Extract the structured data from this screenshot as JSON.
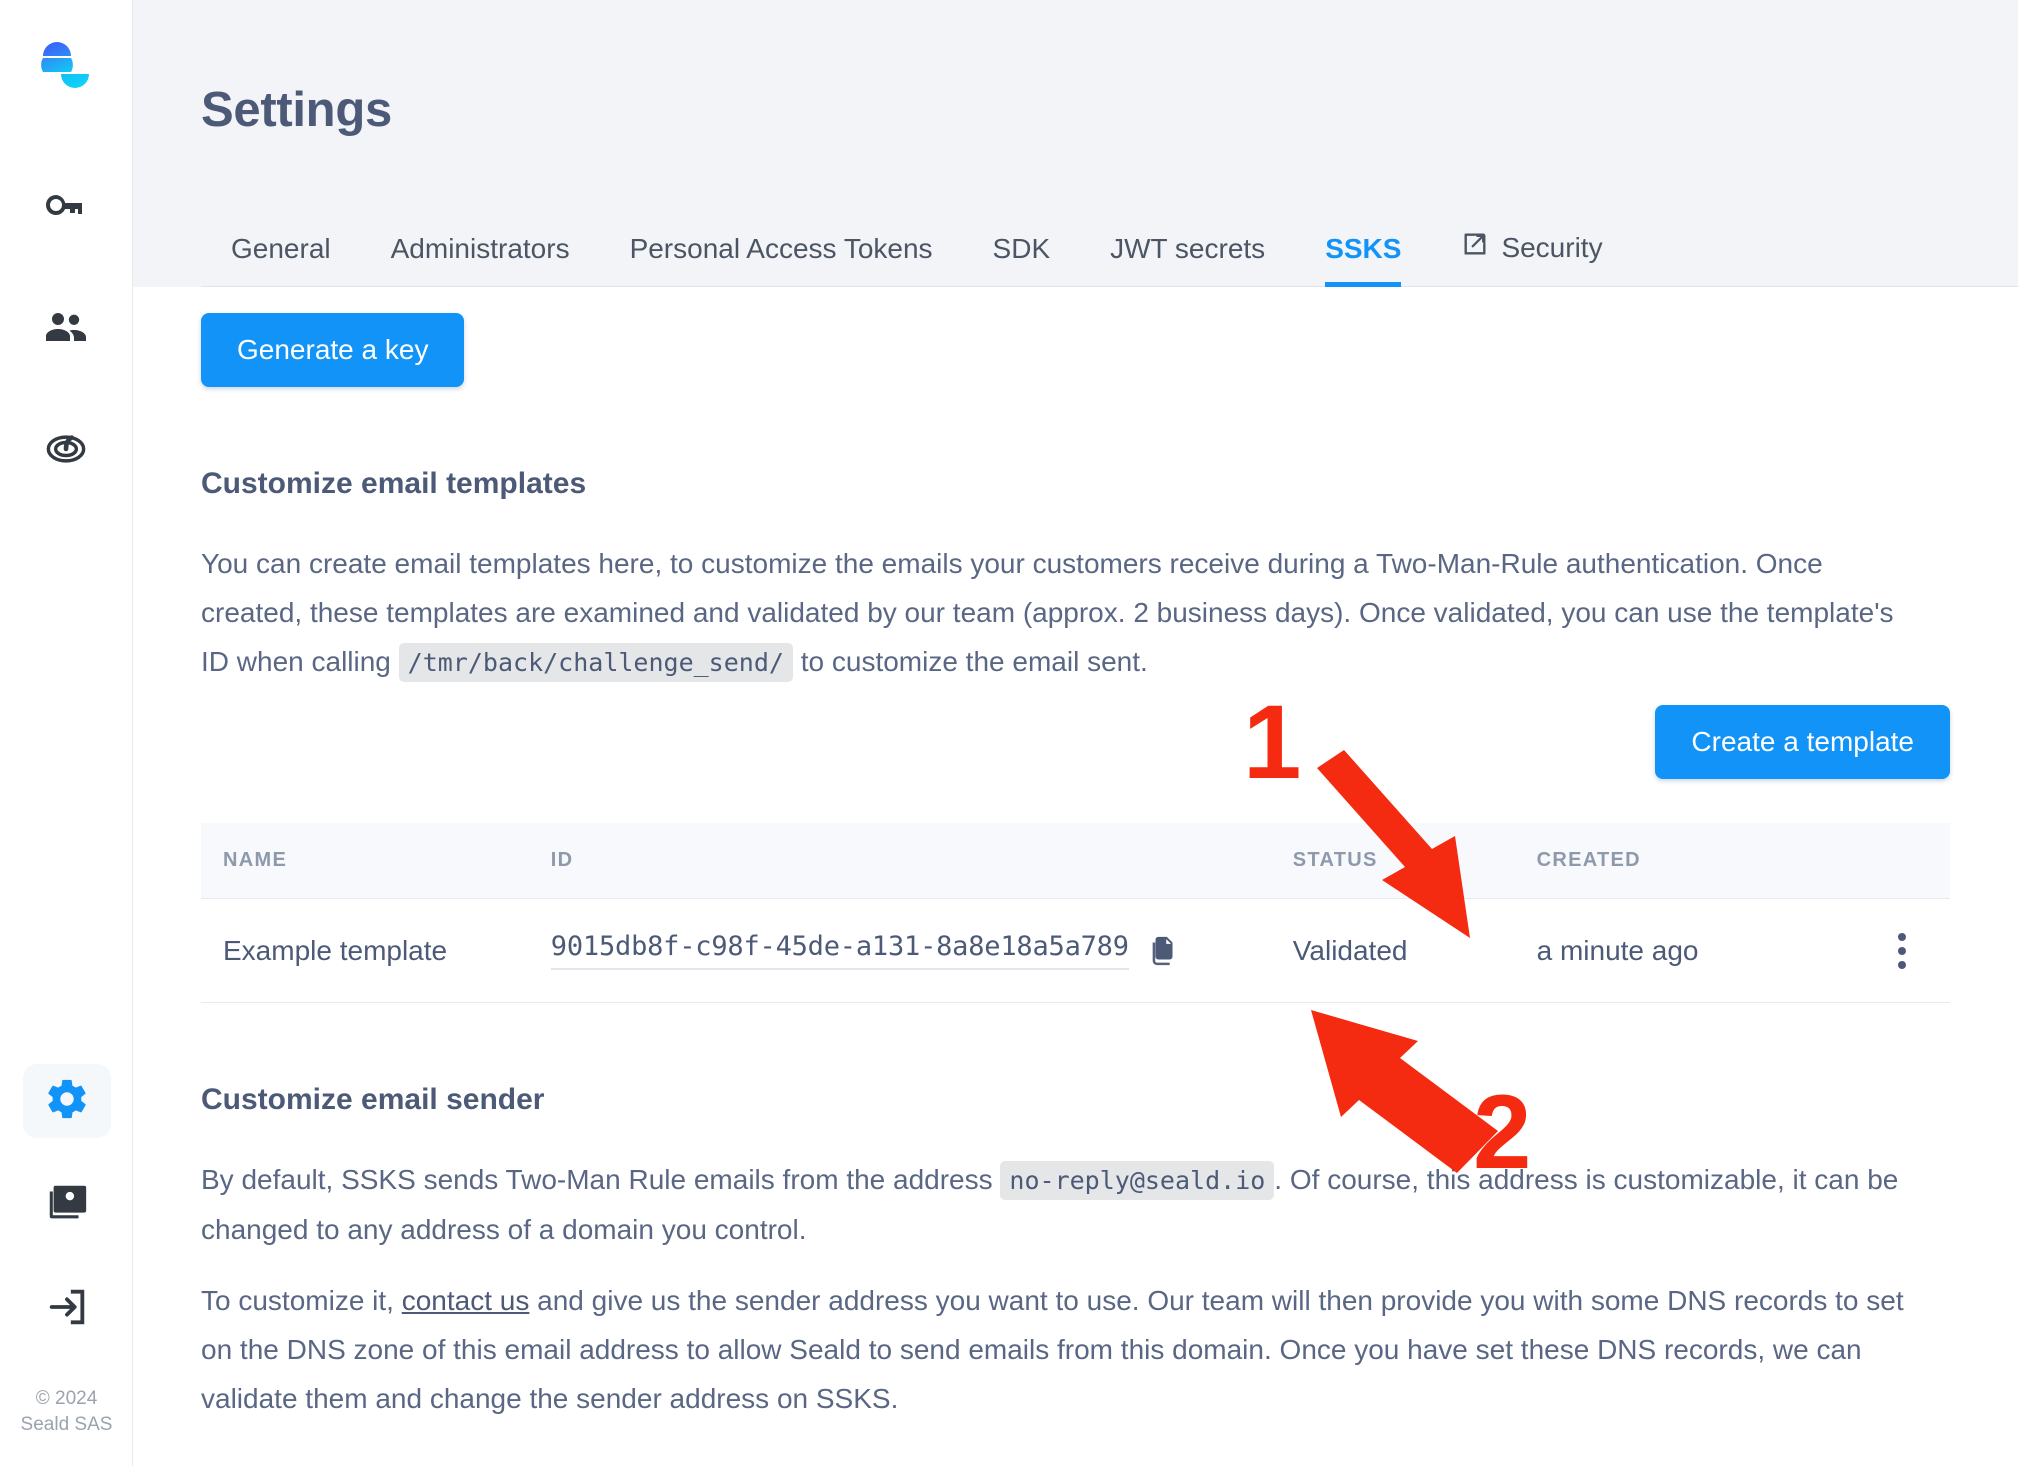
{
  "app": {
    "logo_icon": "seald-logo-icon",
    "copyright_line1": "© 2024",
    "copyright_line2": "Seald SAS"
  },
  "sidebar": {
    "items": [
      {
        "icon": "key-icon",
        "name": "sidebar-item-keys",
        "active": false
      },
      {
        "icon": "people-icon",
        "name": "sidebar-item-users",
        "active": false
      },
      {
        "icon": "target-icon",
        "name": "sidebar-item-activity",
        "active": false
      }
    ],
    "bottom_items": [
      {
        "icon": "gear-icon",
        "name": "sidebar-item-settings",
        "active": true
      },
      {
        "icon": "id-card-icon",
        "name": "sidebar-item-billing",
        "active": false
      },
      {
        "icon": "logout-icon",
        "name": "sidebar-item-logout",
        "active": false
      }
    ]
  },
  "header": {
    "title": "Settings"
  },
  "tabs": [
    {
      "label": "General",
      "active": false,
      "external": false
    },
    {
      "label": "Administrators",
      "active": false,
      "external": false
    },
    {
      "label": "Personal Access Tokens",
      "active": false,
      "external": false
    },
    {
      "label": "SDK",
      "active": false,
      "external": false
    },
    {
      "label": "JWT secrets",
      "active": false,
      "external": false
    },
    {
      "label": "SSKS",
      "active": true,
      "external": false
    },
    {
      "label": "Security",
      "active": false,
      "external": true
    }
  ],
  "main": {
    "generate_key_label": "Generate a key",
    "templates_section": {
      "title": "Customize email templates",
      "paragraph_part1": "You can create email templates here, to customize the emails your customers receive during a Two-Man-Rule authentication. Once created, these templates are examined and validated by our team (approx. 2 business days). Once validated, you can use the template's ID when calling",
      "paragraph_code": "/tmr/back/challenge_send/",
      "paragraph_part2": "to customize the email sent.",
      "create_template_label": "Create a template"
    },
    "table": {
      "columns": [
        "NAME",
        "ID",
        "STATUS",
        "CREATED"
      ],
      "rows": [
        {
          "name": "Example template",
          "id": "9015db8f-c98f-45de-a131-8a8e18a5a789",
          "status": "Validated",
          "created": "a minute ago",
          "copy_icon": "copy-icon",
          "menu_icon": "kebab-menu-icon"
        }
      ]
    },
    "sender_section": {
      "title": "Customize email sender",
      "p1_part1": "By default, SSKS sends Two-Man Rule emails from the address",
      "p1_code": "no-reply@seald.io",
      "p1_part2": ". Of course, this address is customizable, it can be changed to any address of a domain you control.",
      "p2_part1": "To customize it,",
      "p2_link": "contact us",
      "p2_part2": "and give us the sender address you want to use. Our team will then provide you with some DNS records to set on the DNS zone of this email address to allow Seald to send emails from this domain. Once you have set these DNS records, we can validate them and change the sender address on SSKS."
    }
  },
  "annotations": [
    {
      "label": "1",
      "name": "annotation-marker-1"
    },
    {
      "label": "2",
      "name": "annotation-marker-2"
    }
  ],
  "colors": {
    "accent": "#1193f7",
    "annotation_red": "#f52b11",
    "text": "#4c5a77",
    "header_bg": "#f2f4f8"
  }
}
